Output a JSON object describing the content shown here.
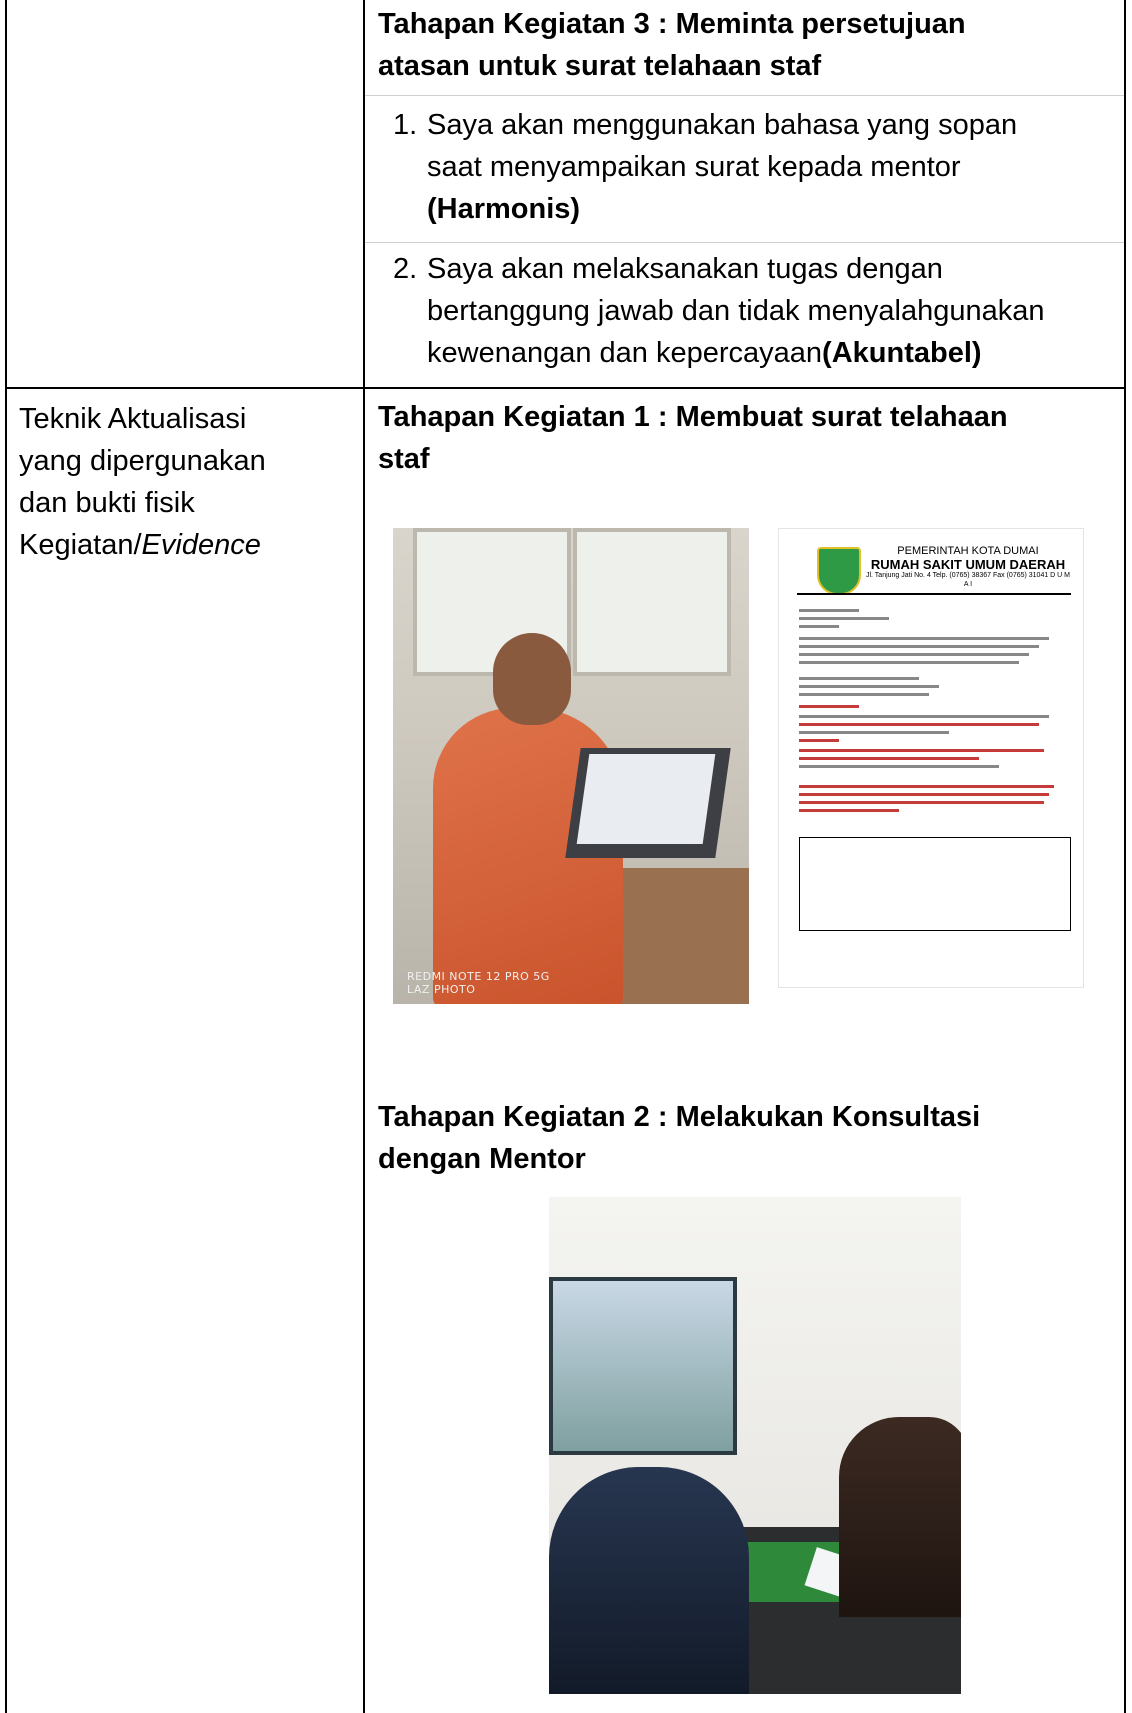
{
  "left_column": {
    "label_line1": "Teknik Aktualisasi",
    "label_line2": "yang dipergunakan",
    "label_line3": "dan bukti fisik",
    "label_line4_plain": "Kegiatan/",
    "label_line4_italic": "Evidence"
  },
  "stage3": {
    "title_line1": "Tahapan Kegiatan 3 : Meminta persetujuan",
    "title_line2": "atasan untuk surat telahaan staf",
    "items": [
      {
        "number": "1.",
        "line1": "Saya akan menggunakan bahasa yang sopan",
        "line2": "saat menyampaikan surat kepada mentor",
        "bold": "(Harmonis)"
      },
      {
        "number": "2.",
        "line1": "Saya akan melaksanakan tugas dengan",
        "line2": "bertanggung jawab dan tidak menyalahgunakan",
        "line3_plain": "kewenangan dan kepercayaan",
        "bold": "(Akuntabel)"
      }
    ]
  },
  "stage1": {
    "title_line1": "Tahapan Kegiatan 1 : Membuat surat telahaan",
    "title_line2": "staf",
    "photo_caption_line1": "REDMI NOTE 12 PRO 5G",
    "photo_caption_line2": "LAZ PHOTO",
    "doc_header1": "PEMERINTAH KOTA DUMAI",
    "doc_header2": "RUMAH SAKIT UMUM DAERAH",
    "doc_header3": "Jl. Tanjung Jati No. 4 Telp. (0765) 38367 Fax (0765) 31041 D U M A I"
  },
  "stage2": {
    "title_line1": "Tahapan Kegiatan 2 : Melakukan Konsultasi",
    "title_line2": "dengan Mentor"
  }
}
